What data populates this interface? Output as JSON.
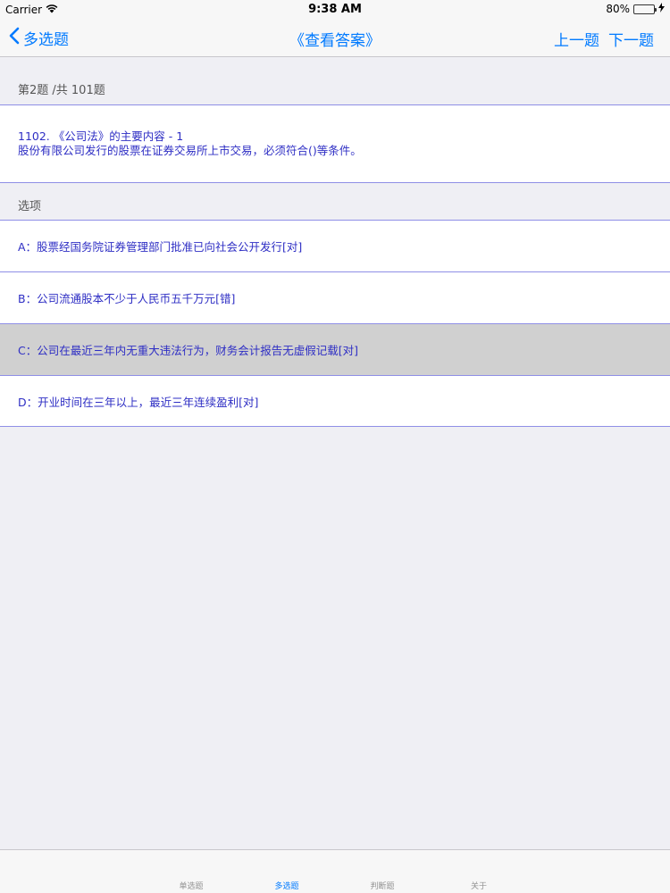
{
  "status_bar": {
    "carrier": "Carrier",
    "time": "9:38 AM",
    "battery_percent": "80%",
    "battery_level": 0.8
  },
  "nav": {
    "back_label": "多选题",
    "title": "《查看答案》",
    "prev_label": "上一题",
    "next_label": "下一题"
  },
  "question": {
    "progress": "第2题 /共 101题",
    "title": "1102. 《公司法》的主要内容 - 1",
    "text": "股份有限公司发行的股票在证券交易所上市交易，必须符合()等条件。"
  },
  "options_header": "选项",
  "options": [
    {
      "label": "A：股票经国务院证券管理部门批准已向社会公开发行[对]"
    },
    {
      "label": "B：公司流通股本不少于人民币五千万元[错]"
    },
    {
      "label": "C：公司在最近三年内无重大违法行为，财务会计报告无虚假记载[对]"
    },
    {
      "label": "D：开业时间在三年以上，最近三年连续盈利[对]"
    }
  ],
  "tabs": [
    {
      "label": "单选题"
    },
    {
      "label": "多选题"
    },
    {
      "label": "判断题"
    },
    {
      "label": "关于"
    }
  ],
  "colors": {
    "accent": "#007aff",
    "text_blue": "#2e2ec4",
    "divider": "#8f8fe6",
    "selected_row": "#d0d0d0"
  }
}
